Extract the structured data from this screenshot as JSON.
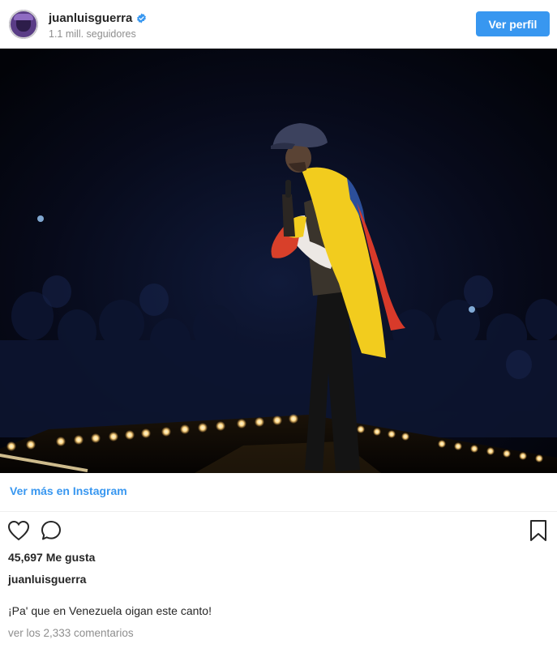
{
  "header": {
    "avatar_icon": "profile-avatar",
    "username": "juanluisguerra",
    "verified_icon": "verified-badge-icon",
    "followers": "1.1 mill. seguidores",
    "view_profile_label": "Ver perfil"
  },
  "post": {
    "photo_description_icon": "concert-photo",
    "more_link": "Ver más en Instagram",
    "like_icon": "heart-icon",
    "comment_icon": "comment-bubble-icon",
    "save_icon": "bookmark-icon",
    "likes": "45,697 Me gusta",
    "author": "juanluisguerra",
    "caption": "¡Pa' que en Venezuela oigan este canto!",
    "comments_link": "ver los 2,333 comentarios"
  },
  "colors": {
    "accent": "#3897f0",
    "text": "#262626",
    "muted": "#8e8e8e"
  }
}
